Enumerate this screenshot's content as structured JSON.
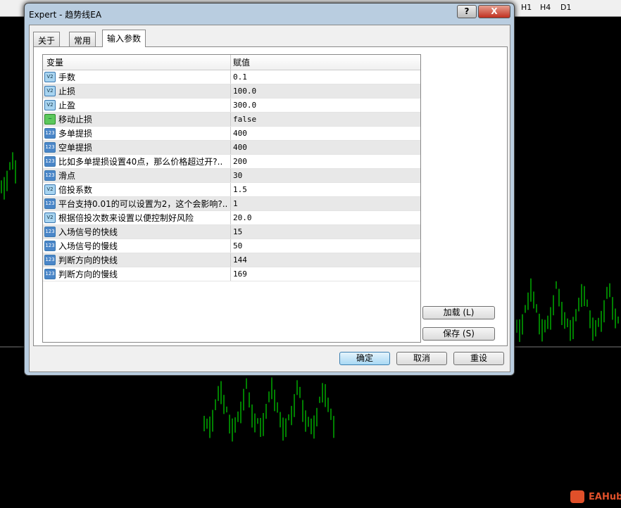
{
  "toolbar": {
    "timeframes": [
      "H1",
      "H4",
      "D1"
    ]
  },
  "dialog": {
    "title": "Expert - 趋势线EA",
    "help_label": "?",
    "close_label": "X",
    "tabs": [
      {
        "label": "关于"
      },
      {
        "label": "常用"
      },
      {
        "label": "输入参数",
        "active": true
      }
    ],
    "table": {
      "headers": {
        "variable": "变量",
        "value": "赋值"
      },
      "rows": [
        {
          "type": "double",
          "icon": "V2",
          "name": "手数",
          "value": "0.1"
        },
        {
          "type": "double",
          "icon": "V2",
          "name": "止损",
          "value": "100.0"
        },
        {
          "type": "double",
          "icon": "V2",
          "name": "止盈",
          "value": "300.0"
        },
        {
          "type": "bool",
          "icon": "~",
          "name": "移动止损",
          "value": "false"
        },
        {
          "type": "int",
          "icon": "123",
          "name": "多单提损",
          "value": "400"
        },
        {
          "type": "int",
          "icon": "123",
          "name": "空单提损",
          "value": "400"
        },
        {
          "type": "int",
          "icon": "123",
          "name": "比如多单提损设置40点，那么价格超过开?..",
          "value": "200"
        },
        {
          "type": "int",
          "icon": "123",
          "name": "滑点",
          "value": "30"
        },
        {
          "type": "double",
          "icon": "V2",
          "name": "倍投系数",
          "value": "1.5"
        },
        {
          "type": "int",
          "icon": "123",
          "name": "平台支持0.01的可以设置为2，这个会影响?..",
          "value": "1"
        },
        {
          "type": "double",
          "icon": "V2",
          "name": "根据倍投次数来设置以便控制好风险",
          "value": "20.0"
        },
        {
          "type": "int",
          "icon": "123",
          "name": "入场信号的快线",
          "value": "15"
        },
        {
          "type": "int",
          "icon": "123",
          "name": "入场信号的慢线",
          "value": "50"
        },
        {
          "type": "int",
          "icon": "123",
          "name": "判断方向的快线",
          "value": "144"
        },
        {
          "type": "int",
          "icon": "123",
          "name": "判断方向的慢线",
          "value": "169"
        }
      ]
    },
    "side_buttons": {
      "load": "加载 (L)",
      "save": "保存 (S)"
    },
    "footer_buttons": {
      "ok": "确定",
      "cancel": "取消",
      "reset": "重设"
    }
  },
  "watermark": {
    "text": "EAHub"
  },
  "colors": {
    "candle": "#00ff00",
    "chart_bg": "#000000",
    "accent": "#3c7fb1",
    "logo": "#e0502a"
  }
}
